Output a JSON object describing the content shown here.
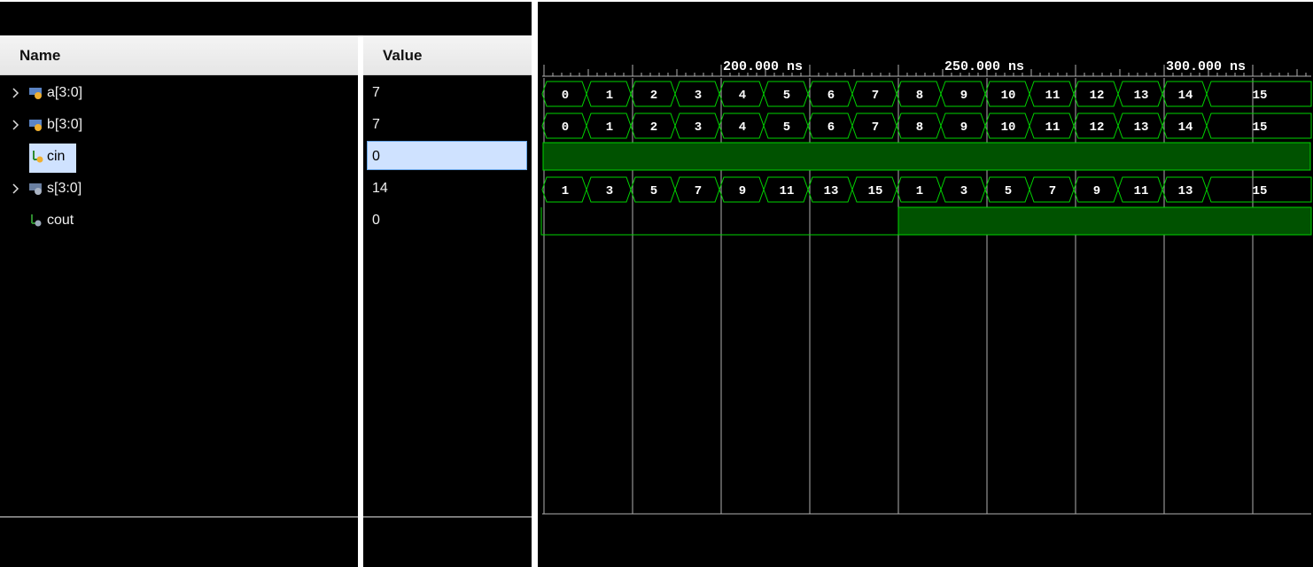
{
  "columns": {
    "name": "Name",
    "value": "Value"
  },
  "signals": [
    {
      "name": "a[3:0]",
      "value": "7",
      "icon": "bus-icon",
      "expandable": true
    },
    {
      "name": "b[3:0]",
      "value": "7",
      "icon": "bus-icon",
      "expandable": true
    },
    {
      "name": "cin",
      "value": "0",
      "icon": "wire-icon",
      "expandable": false,
      "selected": true
    },
    {
      "name": "s[3:0]",
      "value": "14",
      "icon": "bus-icon",
      "expandable": true
    },
    {
      "name": "cout",
      "value": "0",
      "icon": "wire-icon",
      "expandable": false
    }
  ],
  "timeline": {
    "labels": [
      "200.000 ns",
      "250.000 ns",
      "300.000 ns"
    ]
  },
  "waves": {
    "a": [
      "0",
      "1",
      "2",
      "3",
      "4",
      "5",
      "6",
      "7",
      "8",
      "9",
      "10",
      "11",
      "12",
      "13",
      "14",
      "15"
    ],
    "b": [
      "0",
      "1",
      "2",
      "3",
      "4",
      "5",
      "6",
      "7",
      "8",
      "9",
      "10",
      "11",
      "12",
      "13",
      "14",
      "15"
    ],
    "s": [
      "1",
      "3",
      "5",
      "7",
      "9",
      "11",
      "13",
      "15",
      "1",
      "3",
      "5",
      "7",
      "9",
      "11",
      "13",
      "15"
    ],
    "cin_level": "high",
    "cout_levels": [
      "low",
      "high"
    ]
  },
  "colors": {
    "wave": "#00d400",
    "fill": "#005200",
    "grid": "#b0b0b0",
    "selection": "#cfe2ff"
  }
}
